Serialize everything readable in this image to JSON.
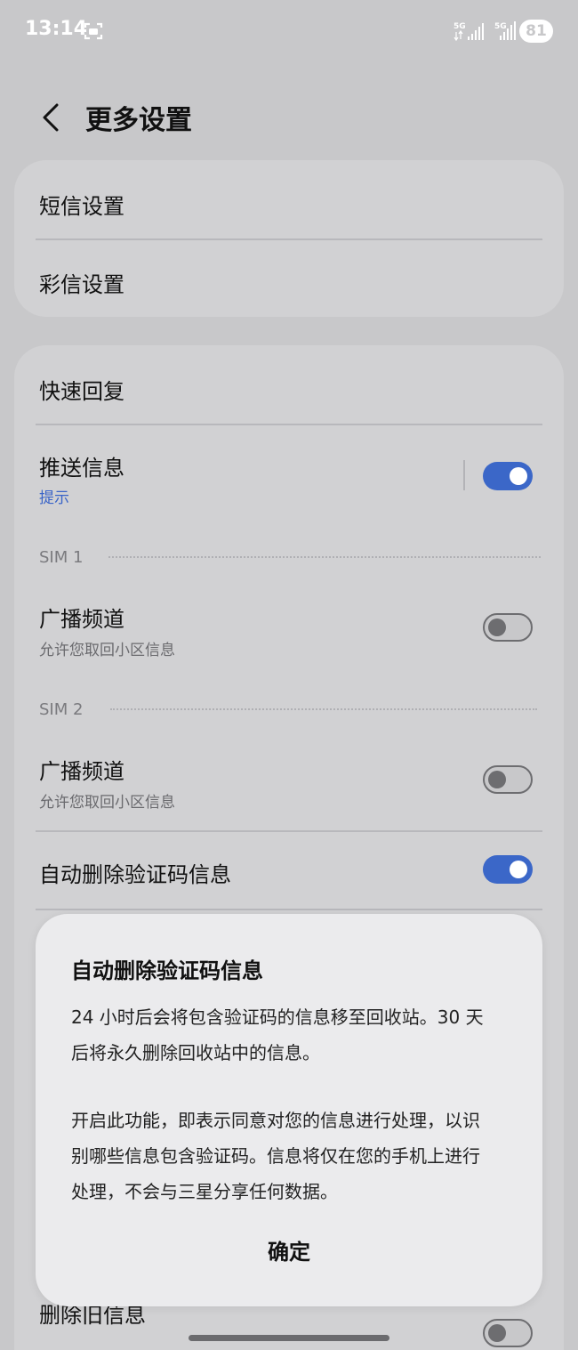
{
  "status_bar": {
    "time": "13:14",
    "network1": "5G",
    "network2": "5G",
    "battery": "81"
  },
  "header": {
    "title": "更多设置"
  },
  "card1": {
    "items": [
      {
        "label": "短信设置"
      },
      {
        "label": "彩信设置"
      }
    ]
  },
  "card2": {
    "quick_reply": "快速回复",
    "push": {
      "label": "推送信息",
      "sub": "提示",
      "on": true
    },
    "sim1": {
      "label": "SIM 1",
      "broadcast_label": "广播频道",
      "broadcast_sub": "允许您取回小区信息",
      "on": false
    },
    "sim2": {
      "label": "SIM 2",
      "broadcast_label": "广播频道",
      "broadcast_sub": "允许您取回小区信息",
      "on": false
    },
    "auto_delete": {
      "label": "自动删除验证码信息",
      "on": true
    },
    "delete_old": {
      "label": "删除旧信息"
    }
  },
  "dialog": {
    "title": "自动删除验证码信息",
    "para1_line1": "24 小时后会将包含验证码的信息移至回收站。30 天",
    "para1_line2": "后将永久删除回收站中的信息。",
    "para2_line1": "开启此功能，即表示同意对您的信息进行处理，以识",
    "para2_line2": "别哪些信息包含验证码。信息将仅在您的手机上进行",
    "para2_line3": "处理，不会与三星分享任何数据。",
    "confirm": "确定"
  },
  "colors": {
    "accent": "#3b67c8",
    "background": "#c8c8ca",
    "card": "#d1d1d3",
    "dialog": "#ebebed"
  }
}
